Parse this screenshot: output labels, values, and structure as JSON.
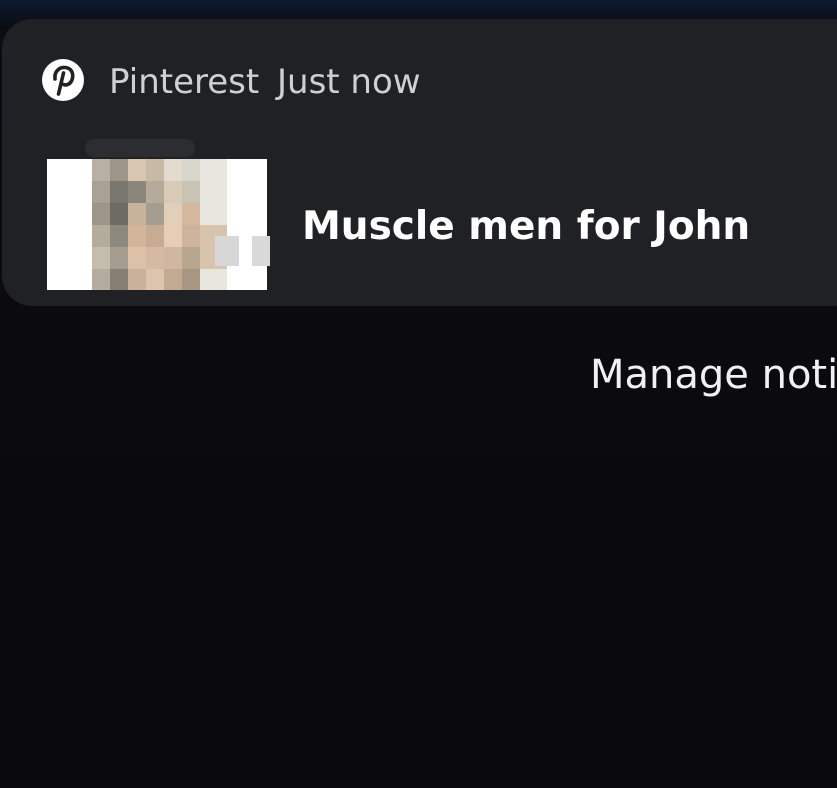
{
  "notification": {
    "app_icon": "pinterest-logo-icon",
    "app_name": "Pinterest",
    "timestamp": "Just now",
    "thumbnail": "pin-thumbnail-blurred-photo",
    "title": "Muscle men for John"
  },
  "manage_button": {
    "label": "Manage noti"
  },
  "colors": {
    "card_background": "#202124",
    "page_background": "#0a0a0c",
    "text_primary": "#ffffff",
    "text_secondary": "#cfd0d4"
  }
}
